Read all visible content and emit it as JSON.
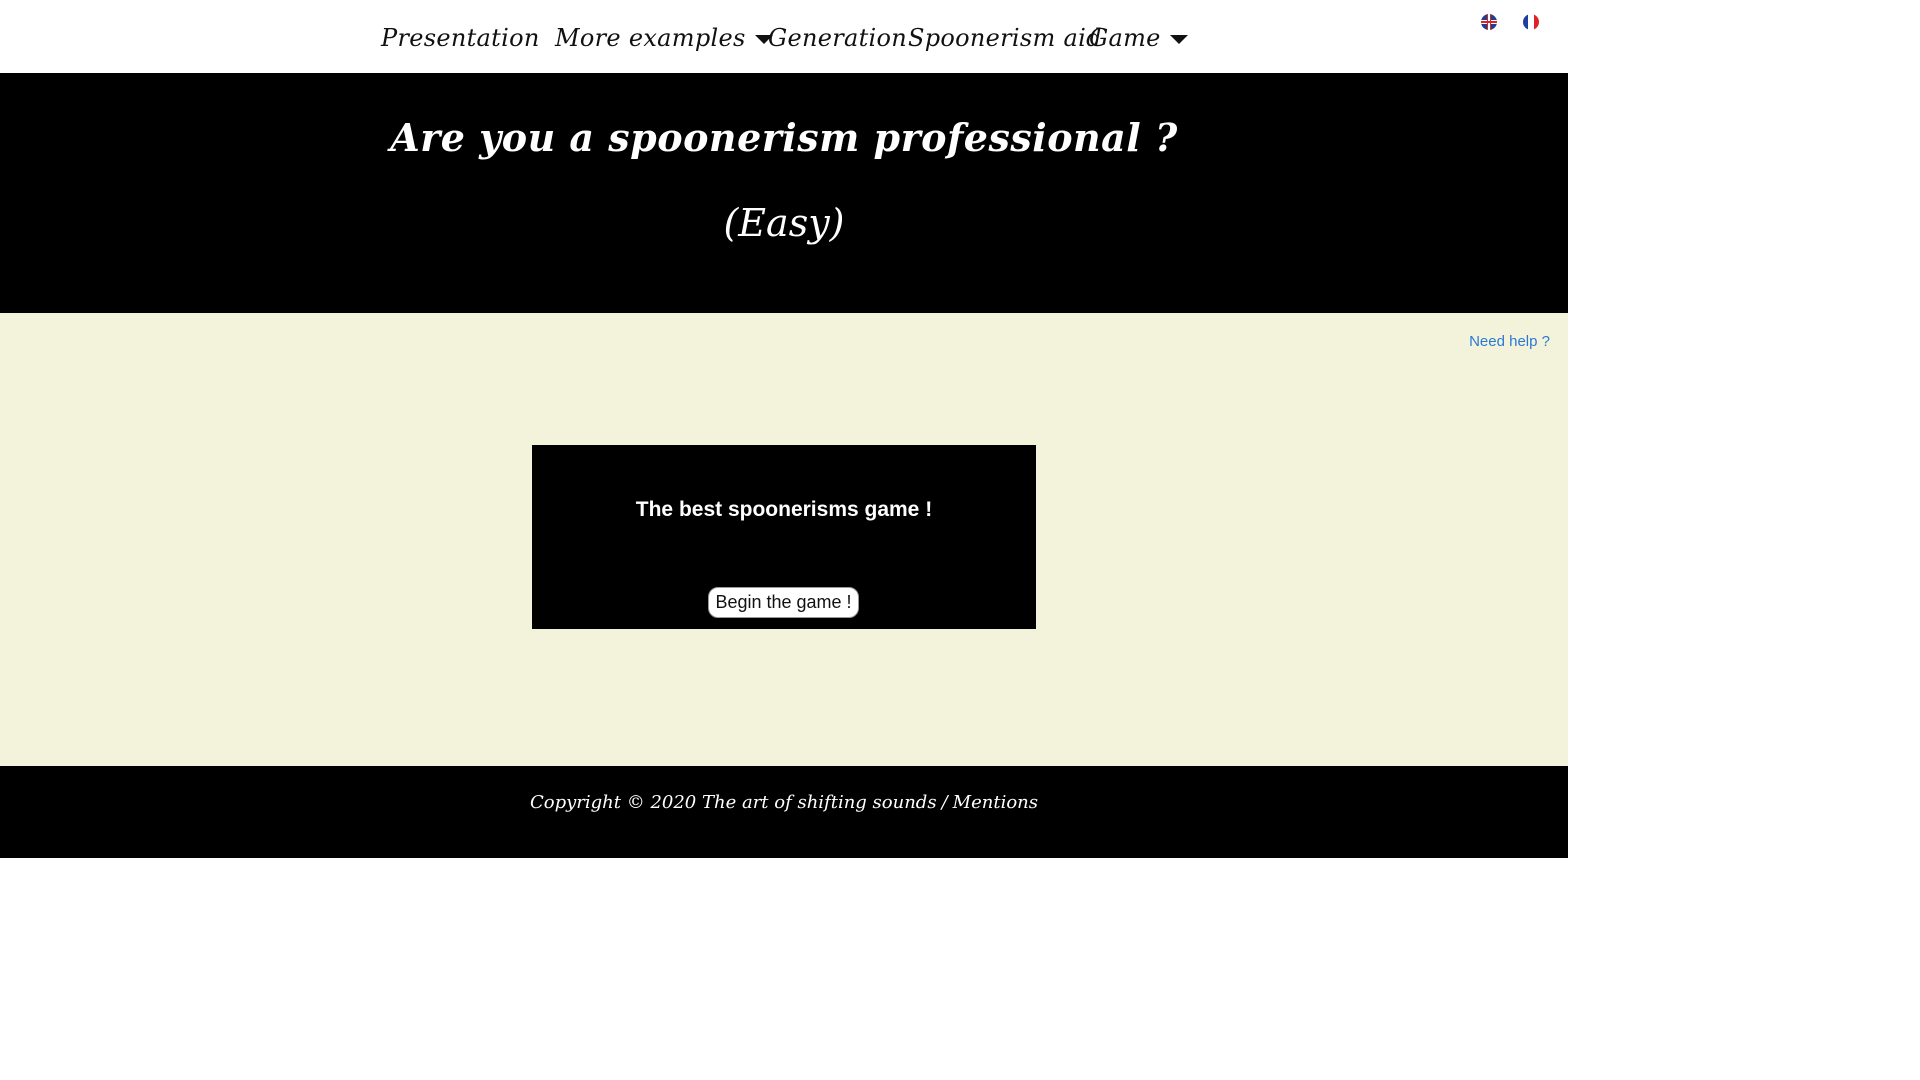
{
  "nav": {
    "presentation": "Presentation",
    "more_examples": "More examples",
    "generation": "Generation",
    "spoonerism_aid": "Spoonerism aid",
    "game": "Game"
  },
  "flags": {
    "english": "uk-flag-icon",
    "french": "france-flag-icon"
  },
  "hero": {
    "title": "Are you a spoonerism professional ?",
    "subtitle": "(Easy)"
  },
  "main": {
    "help_link": "Need help ?",
    "game_heading": "The best spoonerisms game !",
    "begin_button": "Begin the game !"
  },
  "footer": {
    "copyright": "Copyright © 2020 The art of shifting sounds",
    "separator": "/",
    "mentions": "Mentions"
  },
  "colors": {
    "hero_bg": "#000000",
    "main_bg": "#f3f3dc",
    "link": "#2a7ad4",
    "footer_bg": "#000000"
  }
}
